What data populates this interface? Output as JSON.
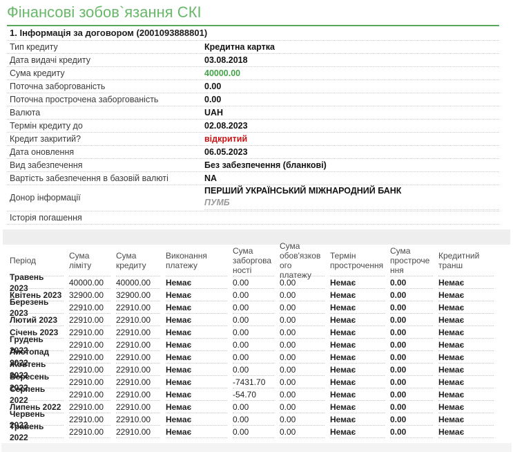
{
  "page": {
    "title": "Фінансові зобов`язання СКІ"
  },
  "section": {
    "heading": "1. Інформація за договором (2001093888801)"
  },
  "details": {
    "rows": [
      {
        "label": "Тип кредиту",
        "value": "Кредитна картка",
        "style": "bold"
      },
      {
        "label": "Дата видачі кредиту",
        "value": "03.08.2018",
        "style": "bold"
      },
      {
        "label": "Сума кредиту",
        "value": "40000.00",
        "style": "green"
      },
      {
        "label": "Поточна заборгованість",
        "value": "0.00",
        "style": "bold"
      },
      {
        "label": "Поточна прострочена заборгованість",
        "value": "0.00",
        "style": "bold"
      },
      {
        "label": "Валюта",
        "value": "UAH",
        "style": "bold"
      },
      {
        "label": "Термін кредиту до",
        "value": "02.08.2023",
        "style": "bold"
      },
      {
        "label": "Кредит закритий?",
        "value": "відкритий",
        "style": "red"
      },
      {
        "label": "Дата оновлення",
        "value": "06.05.2023",
        "style": "bold"
      },
      {
        "label": "Вид забезпечення",
        "value": "Без забезпечення (бланкові)",
        "style": "bold"
      },
      {
        "label": "Вартість забезпечення в базовій валюті",
        "value": "NA",
        "style": "bold"
      },
      {
        "label": "Донор інформації",
        "value": "ПЕРШИЙ УКРАЇНСЬКИЙ МІЖНАРОДНИЙ БАНК",
        "value2": "ПУМБ",
        "style": "bold"
      },
      {
        "label": "Історія погашення",
        "value": "",
        "style": "bold"
      }
    ]
  },
  "history_table": {
    "columns": [
      "Період",
      "Сума ліміту",
      "Сума кредиту",
      "Виконання платежу",
      "Сума заборгованості",
      "Сума обов'язкового платежу",
      "Термін прострочення",
      "Сума прострочення",
      "Кредитний транш"
    ],
    "rows": [
      {
        "period": "Травень 2023",
        "limit": "40000.00",
        "credit": "40000.00",
        "payment": "Немає",
        "debt": "0.00",
        "mandatory": "0.00",
        "overdue_term": "Немає",
        "overdue_sum": "0.00",
        "tranche": "Немає"
      },
      {
        "period": "Квітень 2023",
        "limit": "32900.00",
        "credit": "32900.00",
        "payment": "Немає",
        "debt": "0.00",
        "mandatory": "0.00",
        "overdue_term": "Немає",
        "overdue_sum": "0.00",
        "tranche": "Немає"
      },
      {
        "period": "Березень 2023",
        "limit": "22910.00",
        "credit": "22910.00",
        "payment": "Немає",
        "debt": "0.00",
        "mandatory": "0.00",
        "overdue_term": "Немає",
        "overdue_sum": "0.00",
        "tranche": "Немає"
      },
      {
        "period": "Лютий 2023",
        "limit": "22910.00",
        "credit": "22910.00",
        "payment": "Немає",
        "debt": "0.00",
        "mandatory": "0.00",
        "overdue_term": "Немає",
        "overdue_sum": "0.00",
        "tranche": "Немає"
      },
      {
        "period": "Січень 2023",
        "limit": "22910.00",
        "credit": "22910.00",
        "payment": "Немає",
        "debt": "0.00",
        "mandatory": "0.00",
        "overdue_term": "Немає",
        "overdue_sum": "0.00",
        "tranche": "Немає"
      },
      {
        "period": "Грудень 2022",
        "limit": "22910.00",
        "credit": "22910.00",
        "payment": "Немає",
        "debt": "0.00",
        "mandatory": "0.00",
        "overdue_term": "Немає",
        "overdue_sum": "0.00",
        "tranche": "Немає"
      },
      {
        "period": "Листопад 2022",
        "limit": "22910.00",
        "credit": "22910.00",
        "payment": "Немає",
        "debt": "0.00",
        "mandatory": "0.00",
        "overdue_term": "Немає",
        "overdue_sum": "0.00",
        "tranche": "Немає"
      },
      {
        "period": "Жовтень 2022",
        "limit": "22910.00",
        "credit": "22910.00",
        "payment": "Немає",
        "debt": "0.00",
        "mandatory": "0.00",
        "overdue_term": "Немає",
        "overdue_sum": "0.00",
        "tranche": "Немає"
      },
      {
        "period": "Вересень 2022",
        "limit": "22910.00",
        "credit": "22910.00",
        "payment": "Немає",
        "debt": "-7431.70",
        "mandatory": "0.00",
        "overdue_term": "Немає",
        "overdue_sum": "0.00",
        "tranche": "Немає"
      },
      {
        "period": "Серпень 2022",
        "limit": "22910.00",
        "credit": "22910.00",
        "payment": "Немає",
        "debt": "-54.70",
        "mandatory": "0.00",
        "overdue_term": "Немає",
        "overdue_sum": "0.00",
        "tranche": "Немає"
      },
      {
        "period": "Липень 2022",
        "limit": "22910.00",
        "credit": "22910.00",
        "payment": "Немає",
        "debt": "0.00",
        "mandatory": "0.00",
        "overdue_term": "Немає",
        "overdue_sum": "0.00",
        "tranche": "Немає"
      },
      {
        "period": "Червень 2022",
        "limit": "22910.00",
        "credit": "22910.00",
        "payment": "Немає",
        "debt": "0.00",
        "mandatory": "0.00",
        "overdue_term": "Немає",
        "overdue_sum": "0.00",
        "tranche": "Немає"
      },
      {
        "period": "Травень 2022",
        "limit": "22910.00",
        "credit": "22910.00",
        "payment": "Немає",
        "debt": "0.00",
        "mandatory": "0.00",
        "overdue_term": "Немає",
        "overdue_sum": "0.00",
        "tranche": "Немає"
      }
    ]
  },
  "colors": {
    "accent_green": "#67b868",
    "rule_green": "#58a85a",
    "value_green": "#44a347",
    "status_green": "#1fa21f",
    "status_red": "#cc1414",
    "muted_gray": "#9c9c9c"
  }
}
